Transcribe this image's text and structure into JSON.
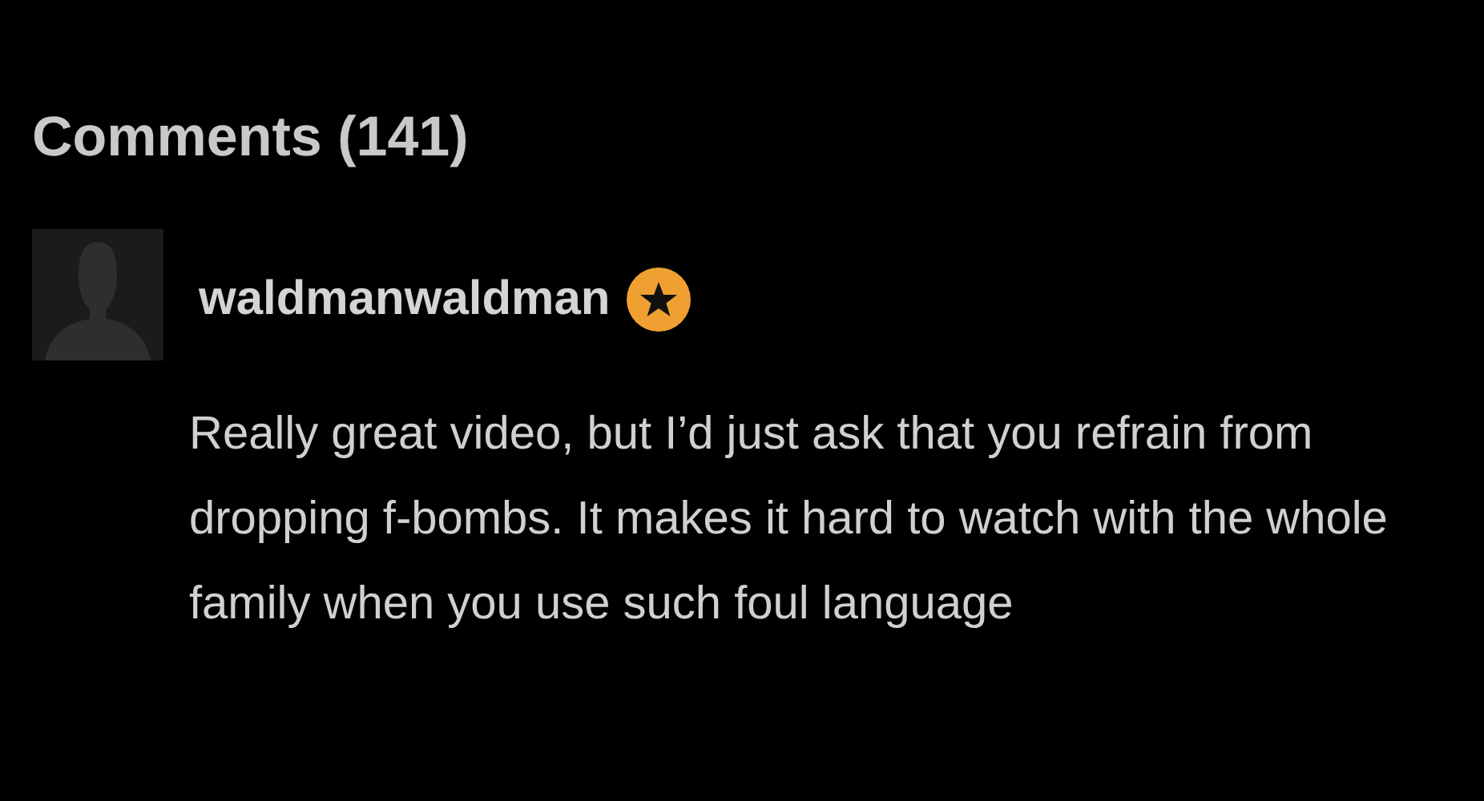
{
  "comments": {
    "title": "Comments (141)",
    "items": [
      {
        "author": "waldmanwaldman",
        "starred": true,
        "text": "Really great video, but I’d just ask that you refrain from dropping f-bombs. It makes it hard to watch with the whole family when you use such foul language"
      }
    ]
  }
}
